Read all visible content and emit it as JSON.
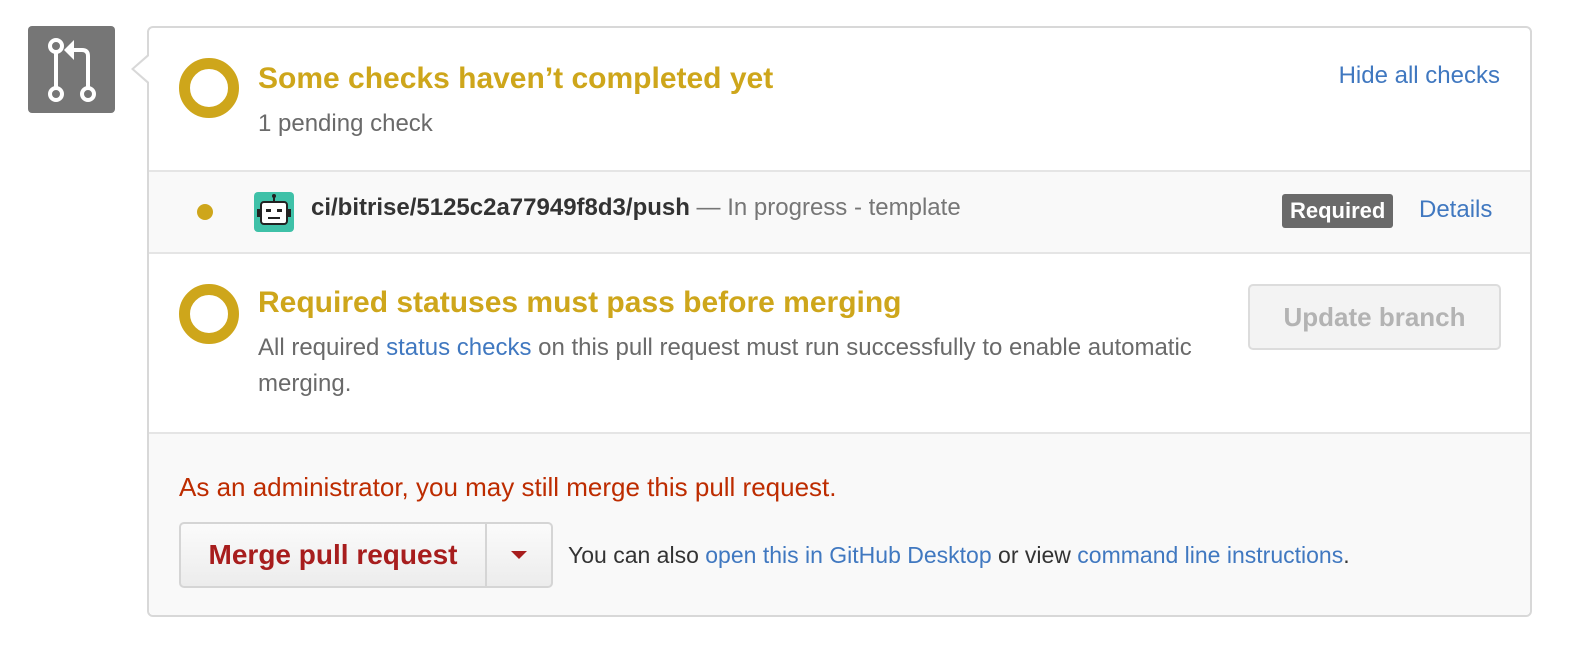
{
  "checks_header": {
    "title": "Some checks haven’t completed yet",
    "subtitle": "1 pending check",
    "toggle_link": "Hide all checks"
  },
  "check_item": {
    "context": "ci/bitrise/5125c2a77949f8d3/push",
    "separator": " — ",
    "description": "In progress - template",
    "badge": "Required",
    "details_link": "Details",
    "status_color": "#cea61b",
    "avatar_color": "#3fc1a8"
  },
  "required_status": {
    "title": "Required statuses must pass before merging",
    "desc_prefix": "All required ",
    "desc_link": "status checks",
    "desc_suffix": " on this pull request must run successfully to enable automatic merging.",
    "update_button": "Update branch"
  },
  "merge": {
    "admin_notice": "As an administrator, you may still merge this pull request.",
    "merge_button": "Merge pull request",
    "also_prefix": "You can also ",
    "desktop_link": "open this in GitHub Desktop",
    "middle_text": " or view ",
    "cli_link": "command line instructions",
    "end_text": "."
  },
  "colors": {
    "pending": "#cea61b",
    "link": "#4078c0",
    "danger": "#bd2c00"
  }
}
